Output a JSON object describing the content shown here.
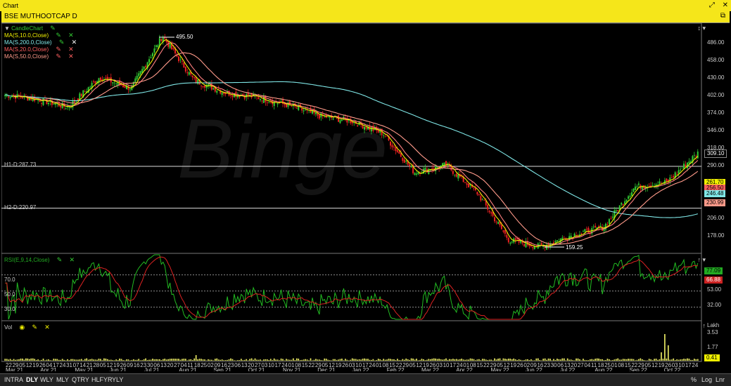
{
  "window": {
    "title": "Chart",
    "pin_icon": "pin-icon",
    "restore_icon": "restore-icon",
    "close_icon": "close-icon"
  },
  "symbol": {
    "label": "BSE MUTHOOTCAP D",
    "restore_icon": "restore-icon"
  },
  "watermark": "Binge",
  "legend": {
    "candle": "CandleChart",
    "ma": [
      {
        "label": "MA(S,10.0,Close)",
        "color": "#f0f000"
      },
      {
        "label": "MA(S,200.0,Close)",
        "color": "#7fe6e6"
      },
      {
        "label": "MA(S,20.0,Close)",
        "color": "#ff8080"
      },
      {
        "label": "MA(S,50.0,Close)",
        "color": "#ff9a8a"
      }
    ]
  },
  "price_pane": {
    "y_ticks": [
      "486.00",
      "458.00",
      "430.00",
      "402.00",
      "374.00",
      "346.00",
      "318.00",
      "290.00",
      "206.00",
      "178.00"
    ],
    "hlines": [
      {
        "label": "H1-D:287.73",
        "value": 287.73
      },
      {
        "label": "H2-D:220.97",
        "value": 220.97
      }
    ],
    "high_annot": "495.50",
    "low_annot": "159.25",
    "tags": [
      {
        "text": "309.10",
        "color": "#ffffff",
        "bg": "#000000"
      },
      {
        "text": "261.70",
        "color": "#000000",
        "bg": "#f0f000"
      },
      {
        "text": "256.50",
        "color": "#000000",
        "bg": "#ff6060"
      },
      {
        "text": "246.48",
        "color": "#000000",
        "bg": "#7fe6e6"
      },
      {
        "text": "230.99",
        "color": "#000000",
        "bg": "#ff9a8a"
      }
    ],
    "pane_icons": "↕ ▾"
  },
  "rsi_pane": {
    "label": "RSI(E,9,14,Close)",
    "levels": [
      "70.0",
      "50.0",
      "30.0"
    ],
    "y_ticks": [
      "53.00",
      "32.00"
    ],
    "tags": [
      {
        "text": "77.09",
        "color": "#000000",
        "bg": "#22aa22"
      },
      {
        "text": "66.88",
        "color": "#ffffff",
        "bg": "#cc2222"
      }
    ],
    "pane_icons": "↑ ▾"
  },
  "vol_pane": {
    "label": "Vol",
    "unit": "Lakh",
    "y_ticks": [
      "3.53",
      "1.77"
    ],
    "tag": {
      "text": "0.41",
      "color": "#000000",
      "bg": "#f0f000"
    },
    "pane_icons": "↑"
  },
  "x_axis": {
    "days": [
      "22",
      "29",
      "05",
      "12",
      "19",
      "26",
      "04",
      "17",
      "24",
      "31",
      "07",
      "14",
      "21",
      "28",
      "05",
      "12",
      "19",
      "26",
      "09",
      "16",
      "23",
      "30",
      "06",
      "13",
      "20",
      "27",
      "04",
      "11",
      "18",
      "25",
      "02",
      "09",
      "16",
      "23",
      "06",
      "13",
      "20",
      "27",
      "03",
      "10",
      "17",
      "24",
      "01",
      "08",
      "15",
      "22",
      "29",
      "05",
      "12",
      "19",
      "26",
      "03",
      "10",
      "17",
      "24",
      "01",
      "08",
      "15",
      "22",
      "29",
      "05",
      "12",
      "19",
      "26",
      "03",
      "10",
      "17",
      "24",
      "01",
      "08",
      "15",
      "22",
      "29",
      "05",
      "12",
      "19",
      "26",
      "02",
      "09",
      "16",
      "23",
      "30",
      "06",
      "13",
      "20",
      "27",
      "04",
      "11",
      "18",
      "25",
      "01",
      "08",
      "15",
      "22",
      "29",
      "05",
      "12",
      "19",
      "26",
      "03",
      "10",
      "17",
      "24"
    ],
    "months": [
      "Mar 21",
      "Apr 21",
      "May 21",
      "Jun 21",
      "Jul 21",
      "Aug 21",
      "Sep 21",
      "Oct 21",
      "Nov 21",
      "Dec 21",
      "Jan 22",
      "Feb 22",
      "Mar 22",
      "Apr 22",
      "May 22",
      "Jun 22",
      "Jul 22",
      "Aug 22",
      "Sep 22",
      "Oct 22"
    ]
  },
  "bottom_bar": {
    "timeframes": [
      "INTRA",
      "DLY",
      "WLY",
      "MLY",
      "QTRY",
      "HLFYR",
      "YLY"
    ],
    "active_timeframe": "DLY",
    "right_buttons": [
      "%",
      "Log",
      "Lnr"
    ]
  },
  "chart_data": {
    "type": "candlestick",
    "symbol": "BSE MUTHOOTCAP",
    "price_range": [
      150,
      500
    ],
    "x_range": [
      "Mar 2021",
      "Oct 2022"
    ],
    "close_path": [
      [
        "Mar 21",
        402
      ],
      [
        "Apr 21",
        395
      ],
      [
        "May 21",
        382
      ],
      [
        "Jun 21",
        430
      ],
      [
        "Jul 21",
        412
      ],
      [
        "Jul 21 high",
        495.5
      ],
      [
        "Aug 21",
        425
      ],
      [
        "Sep 21",
        405
      ],
      [
        "Oct 21",
        398
      ],
      [
        "Nov 21",
        385
      ],
      [
        "Dec 21",
        368
      ],
      [
        "Jan 22",
        360
      ],
      [
        "Feb 22",
        340
      ],
      [
        "Mar 22",
        278
      ],
      [
        "Apr 22",
        290
      ],
      [
        "May 22",
        245
      ],
      [
        "Jun 22",
        170
      ],
      [
        "Jun 22 low",
        159.25
      ],
      [
        "Jul 22",
        178
      ],
      [
        "Aug 22",
        190
      ],
      [
        "Sep 22",
        255
      ],
      [
        "Oct 22",
        262
      ],
      [
        "last",
        309.1
      ]
    ],
    "indicators": {
      "MA10": 261.7,
      "MA20": 256.5,
      "MA200": 246.48,
      "MA50": 230.99,
      "RSI": 77.09,
      "RSI_signal": 66.88,
      "Volume_lakh": 0.41
    }
  }
}
